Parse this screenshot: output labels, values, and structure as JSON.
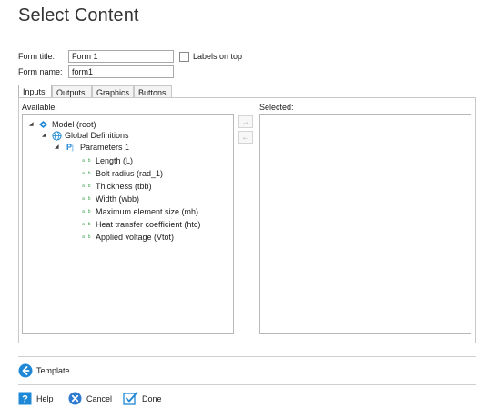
{
  "dialog": {
    "title": "Select Content"
  },
  "form": {
    "title_label": "Form title:",
    "title_value": "Form 1",
    "name_label": "Form name:",
    "name_value": "form1",
    "labels_on_top_label": "Labels on top",
    "labels_on_top_checked": false
  },
  "tabs": [
    {
      "label": "Inputs",
      "active": true
    },
    {
      "label": "Outputs",
      "active": false
    },
    {
      "label": "Graphics",
      "active": false
    },
    {
      "label": "Buttons",
      "active": false
    }
  ],
  "available": {
    "label": "Available:",
    "tree": {
      "model_label": "Model (root)",
      "global_definitions_label": "Global Definitions",
      "parameters_label": "Parameters 1",
      "parameters": [
        "Length (L)",
        "Bolt radius (rad_1)",
        "Thickness (tbb)",
        "Width (wbb)",
        "Maximum element size (mh)",
        "Heat transfer coefficient (htc)",
        "Applied voltage (Vtot)"
      ]
    }
  },
  "selected": {
    "label": "Selected:"
  },
  "icons": {
    "model": "model-node-icon",
    "global": "globe-icon",
    "parameters": "parameters-icon",
    "parameter": "parameter-icon",
    "move_right": "arrow-right-icon",
    "move_left": "arrow-left-icon",
    "template": "arrow-left-circle-icon",
    "help": "help-icon",
    "cancel": "cancel-icon",
    "done": "done-check-icon"
  },
  "colors": {
    "accent_blue": "#1e88d6",
    "param_green": "#4aa55a",
    "cancel_blue": "#2f7bd0"
  },
  "buttons": {
    "template_label": "Template",
    "help_label": "Help",
    "cancel_label": "Cancel",
    "done_label": "Done"
  }
}
